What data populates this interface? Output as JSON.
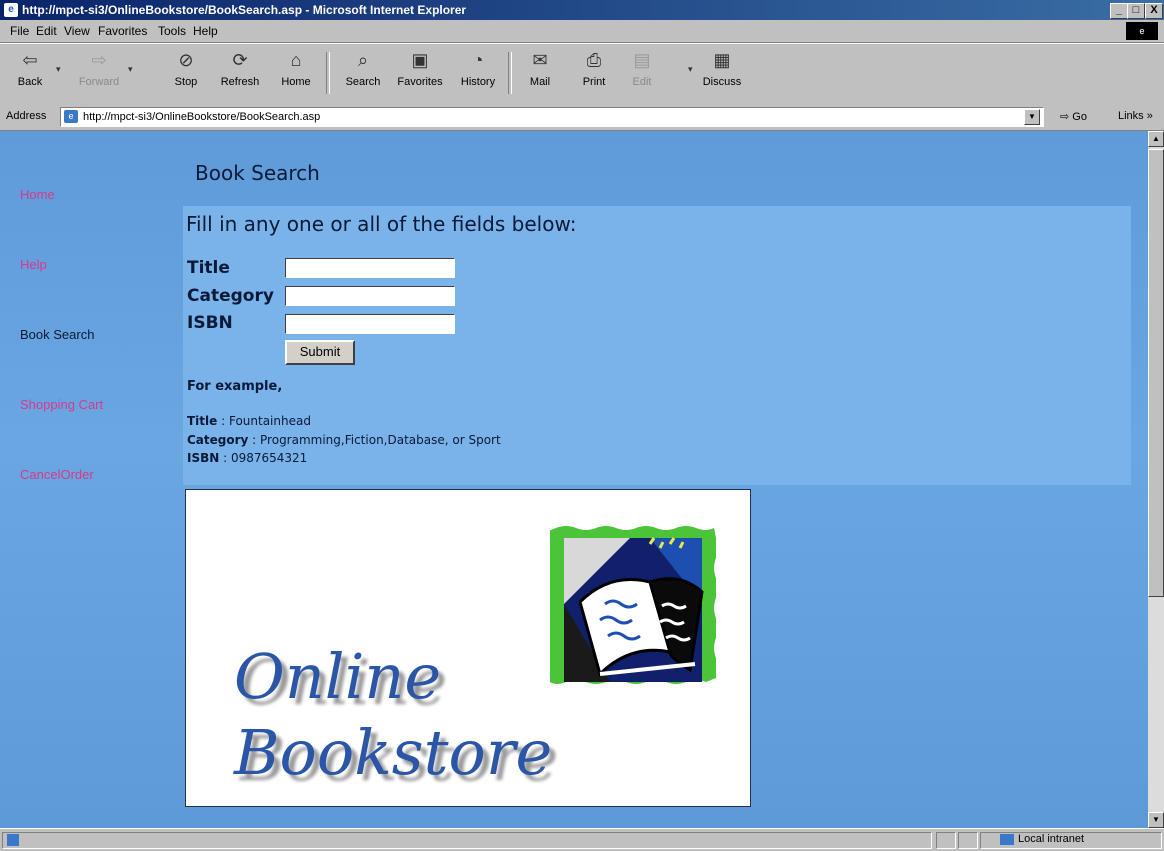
{
  "window": {
    "title": "http://mpct-si3/OnlineBookstore/BookSearch.asp - Microsoft Internet Explorer",
    "minimize": "_",
    "maximize": "□",
    "close": "X"
  },
  "menu": [
    "File",
    "Edit",
    "View",
    "Favorites",
    "Tools",
    "Help"
  ],
  "toolbar": {
    "back": "Back",
    "forward": "Forward",
    "stop": "Stop",
    "refresh": "Refresh",
    "home": "Home",
    "search": "Search",
    "favorites": "Favorites",
    "history": "History",
    "mail": "Mail",
    "print": "Print",
    "edit": "Edit",
    "discuss": "Discuss"
  },
  "address": {
    "label": "Address",
    "url": "http://mpct-si3/OnlineBookstore/BookSearch.asp",
    "go": "Go",
    "links": "Links »"
  },
  "sidebar": {
    "items": [
      {
        "label": "Home"
      },
      {
        "label": "Help"
      },
      {
        "label": "Book Search"
      },
      {
        "label": "Shopping Cart"
      },
      {
        "label": "CancelOrder"
      }
    ]
  },
  "page": {
    "title": "Book Search",
    "heading": "Fill in any one or all of the fields below:",
    "fields": {
      "title_label": "Title",
      "category_label": "Category",
      "isbn_label": "ISBN",
      "title_value": "",
      "category_value": "",
      "isbn_value": ""
    },
    "submit": "Submit",
    "example": {
      "intro": "For example,",
      "title_key": "Title",
      "title_val": " : Fountainhead",
      "category_key": "Category",
      "category_val": " : Programming,Fiction,Database, or Sport",
      "isbn_key": "ISBN",
      "isbn_val": " : 0987654321"
    },
    "banner": {
      "line1": "Online",
      "line2": "Bookstore"
    }
  },
  "status": {
    "zone": "Local intranet"
  },
  "colors": {
    "page_bg": "#6aa6e2",
    "form_bg": "#79b3ea",
    "nav_link": "#d63a8a",
    "nav_current": "#0b1a38",
    "banner_text": "#2b56a8"
  }
}
